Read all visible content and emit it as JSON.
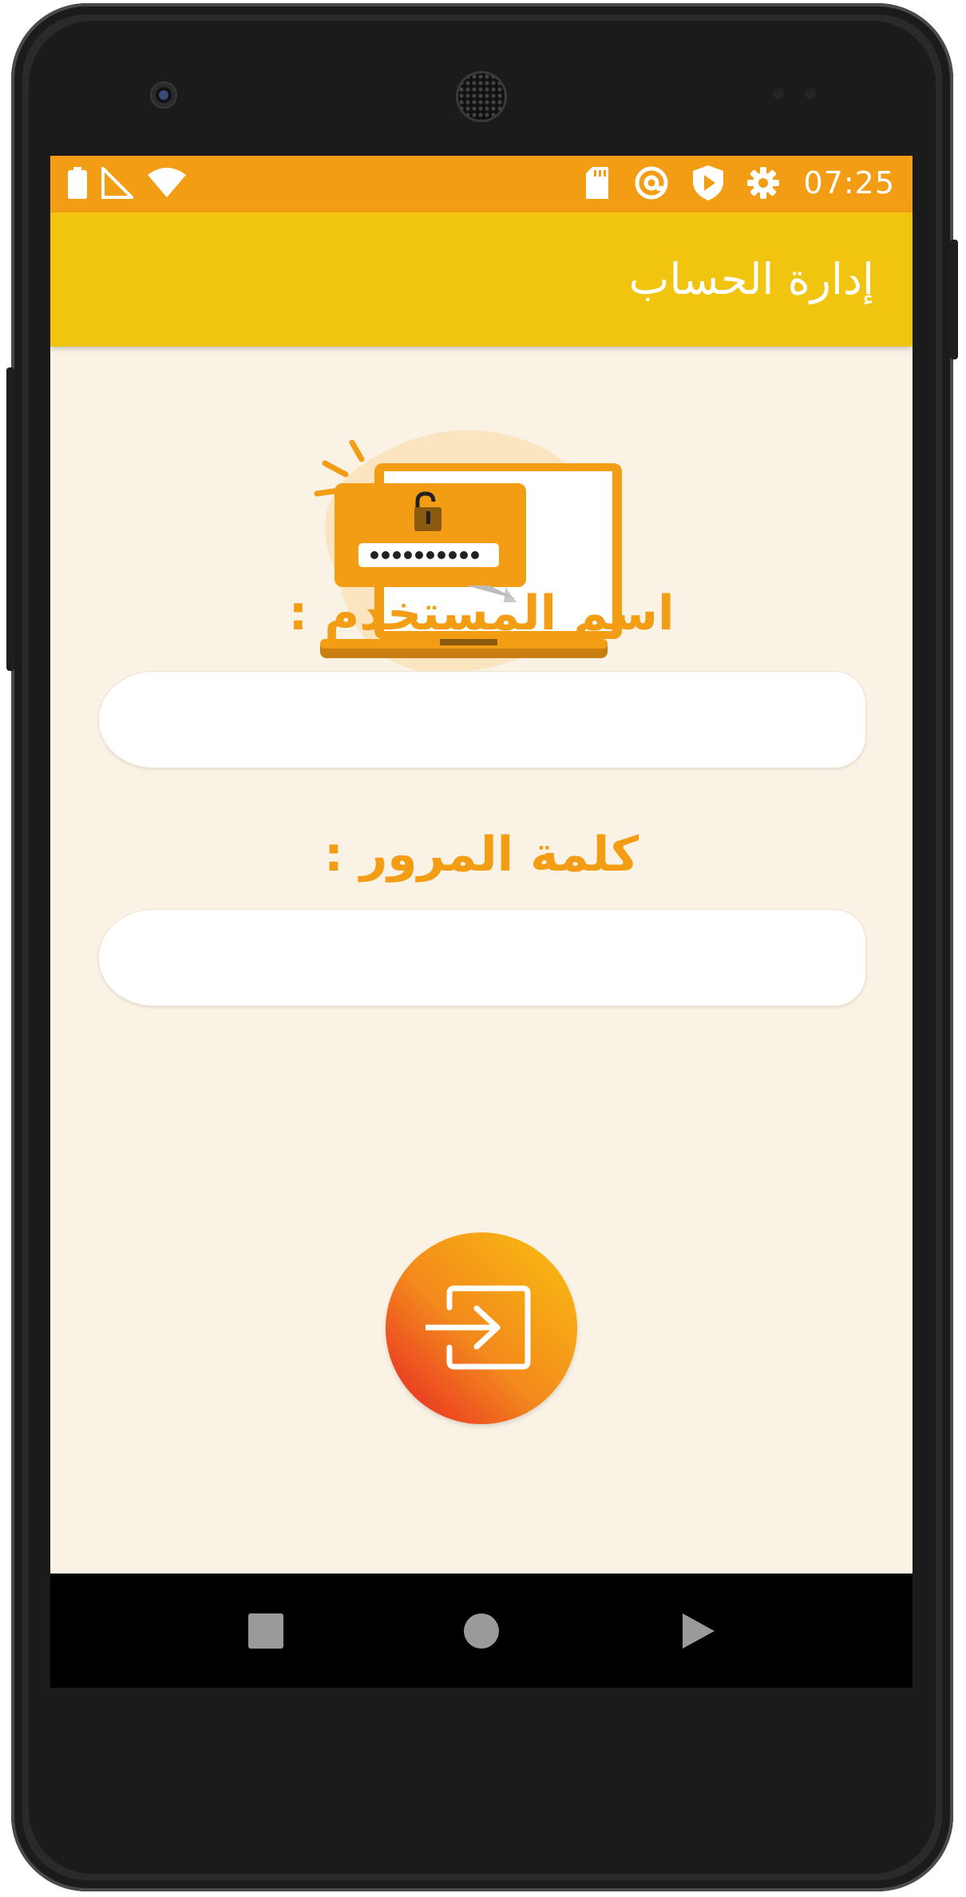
{
  "status_bar": {
    "time": "07:25",
    "left_icons": [
      "battery-icon",
      "no-signal-icon",
      "wifi-icon"
    ],
    "right_icons": [
      "sd-card-icon",
      "at-sign-icon",
      "shield-play-icon",
      "gear-icon"
    ]
  },
  "app_bar": {
    "title": "إدارة الحساب"
  },
  "login_form": {
    "username_label": "اسم المستخدم :",
    "username_value": "",
    "password_label": "كلمة المرور :",
    "password_value": "",
    "login_icon": "login-icon"
  },
  "nav_bar": {
    "buttons": [
      "recents-square-icon",
      "home-circle-icon",
      "back-triangle-icon"
    ]
  },
  "colors": {
    "status_bar": "#f29d14",
    "app_bar": "#f1c410",
    "background": "#f9f2e5",
    "accent": "#f29d14",
    "button_gradient_start": "#f9c010",
    "button_gradient_end": "#e81f25"
  }
}
